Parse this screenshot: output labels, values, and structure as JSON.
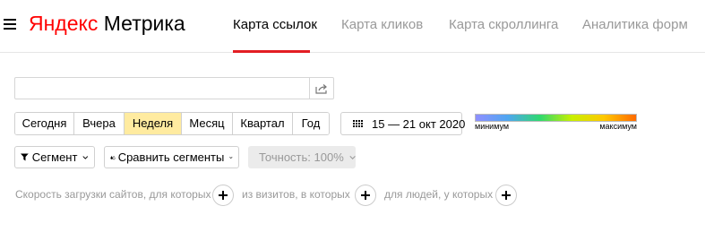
{
  "header": {
    "logo_brand": "Яндекс",
    "logo_product": "Метрика",
    "tabs": [
      {
        "label": "Карта ссылок",
        "active": true
      },
      {
        "label": "Карта кликов",
        "active": false
      },
      {
        "label": "Карта скроллинга",
        "active": false
      },
      {
        "label": "Аналитика форм",
        "active": false
      }
    ]
  },
  "search": {
    "value": "",
    "placeholder": ""
  },
  "periods": [
    {
      "label": "Сегодня",
      "selected": false
    },
    {
      "label": "Вчера",
      "selected": false
    },
    {
      "label": "Неделя",
      "selected": true
    },
    {
      "label": "Месяц",
      "selected": false
    },
    {
      "label": "Квартал",
      "selected": false
    },
    {
      "label": "Год",
      "selected": false
    }
  ],
  "date_range": "15 — 21 окт 2020",
  "legend": {
    "min_label": "минимум",
    "max_label": "максимум"
  },
  "segment_button": "Сегмент",
  "compare_button": "Сравнить сегменты",
  "accuracy": "Точность: 100%",
  "filters": {
    "part1": "Скорость загрузки сайтов, для которых",
    "part2": "из визитов, в которых",
    "part3": "для людей, у которых"
  },
  "colors": {
    "accent_red": "#e31e24",
    "selected_period": "#ffeba0"
  }
}
